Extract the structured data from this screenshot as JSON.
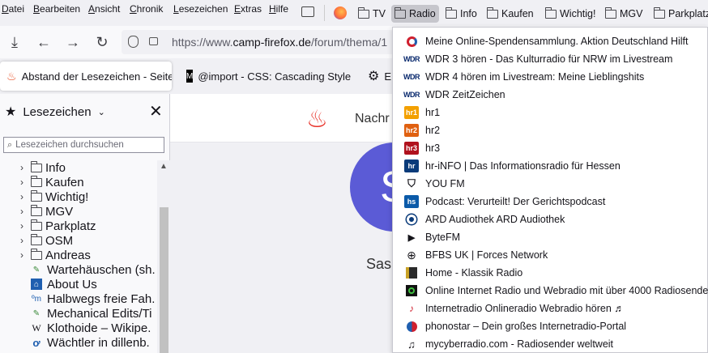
{
  "menubar": {
    "items": [
      {
        "underline": "D",
        "rest": "atei"
      },
      {
        "underline": "B",
        "rest": "earbeiten"
      },
      {
        "underline": "A",
        "rest": "nsicht"
      },
      {
        "underline": "C",
        "rest": "hronik"
      },
      {
        "underline": "L",
        "rest": "esezeichen"
      },
      {
        "underline": "E",
        "rest": "xtras"
      },
      {
        "underline": "H",
        "rest": "ilfe"
      }
    ]
  },
  "bookmarks_toolbar": {
    "items": [
      "TV",
      "Radio",
      "Info",
      "Kaufen",
      "Wichtig!",
      "MGV",
      "Parkplatz"
    ],
    "active": "Radio"
  },
  "navbar": {
    "url_prefix": "https://www.",
    "url_domain": "camp-firefox.de",
    "url_rest": "/forum/thema/1"
  },
  "tabs": [
    {
      "title": "Abstand der Lesezeichen - Seite",
      "selected": true
    },
    {
      "title": "@import - CSS: Cascading Style",
      "selected": false
    },
    {
      "title": "E",
      "selected": false
    }
  ],
  "sidebar": {
    "title": "Lesezeichen",
    "search_placeholder": "Lesezeichen durchsuchen",
    "folders": [
      "Info",
      "Kaufen",
      "Wichtig!",
      "MGV",
      "Parkplatz",
      "OSM",
      "Andreas"
    ],
    "links": [
      {
        "title": "Wartehäuschen (sh.",
        "icon": "map-pin"
      },
      {
        "title": "About Us",
        "icon": "about"
      },
      {
        "title": "Halbwegs freie Fah.",
        "icon": "om"
      },
      {
        "title": "Mechanical Edits/Ti",
        "icon": "map-pin"
      },
      {
        "title": "Klothoide – Wikipe.",
        "icon": "wikipedia"
      },
      {
        "title": "Wächtler in dillenb.",
        "icon": "o-icon"
      }
    ]
  },
  "page": {
    "nav_text": "Nachr",
    "avatar_letter": "S",
    "user_partial": "Sas"
  },
  "radio_menu": {
    "items": [
      {
        "label": "Meine Online-Spendensammlung. Aktion Deutschland Hilft",
        "icon": "spende"
      },
      {
        "label": "WDR 3 hören - Das Kulturradio für NRW im Livestream",
        "icon": "wdr",
        "badge": "WDR"
      },
      {
        "label": "WDR 4 hören im Livestream: Meine Lieblingshits",
        "icon": "wdr",
        "badge": "WDR"
      },
      {
        "label": "WDR ZeitZeichen",
        "icon": "wdr",
        "badge": "WDR"
      },
      {
        "label": "hr1",
        "icon": "hr",
        "badge": "hr1"
      },
      {
        "label": "hr2",
        "icon": "hr",
        "badge": "hr2"
      },
      {
        "label": "hr3",
        "icon": "hr3",
        "badge": "hr3"
      },
      {
        "label": "hr-iNFO | Das Informationsradio für Hessen",
        "icon": "hrinfo",
        "badge": "hr"
      },
      {
        "label": "YOU FM",
        "icon": "youfm"
      },
      {
        "label": "Podcast: Verurteilt! Der Gerichtspodcast",
        "icon": "hs",
        "badge": "hs"
      },
      {
        "label": "ARD Audiothek  ARD Audiothek",
        "icon": "ard"
      },
      {
        "label": "ByteFM",
        "icon": "play"
      },
      {
        "label": "BFBS UK | Forces Network",
        "icon": "globe"
      },
      {
        "label": "Home - Klassik Radio",
        "icon": "klassik"
      },
      {
        "label": "Online Internet Radio und Webradio mit über 4000 Radiosende...",
        "icon": "onlineradio"
      },
      {
        "label": "Internetradio Onlineradio Webradio hören ♬",
        "icon": "radio-red"
      },
      {
        "label": "phonostar – Dein großes Internetradio-Portal",
        "icon": "phonostar"
      },
      {
        "label": "mycyberradio.com - Radiosender weltweit",
        "icon": "note"
      }
    ]
  }
}
